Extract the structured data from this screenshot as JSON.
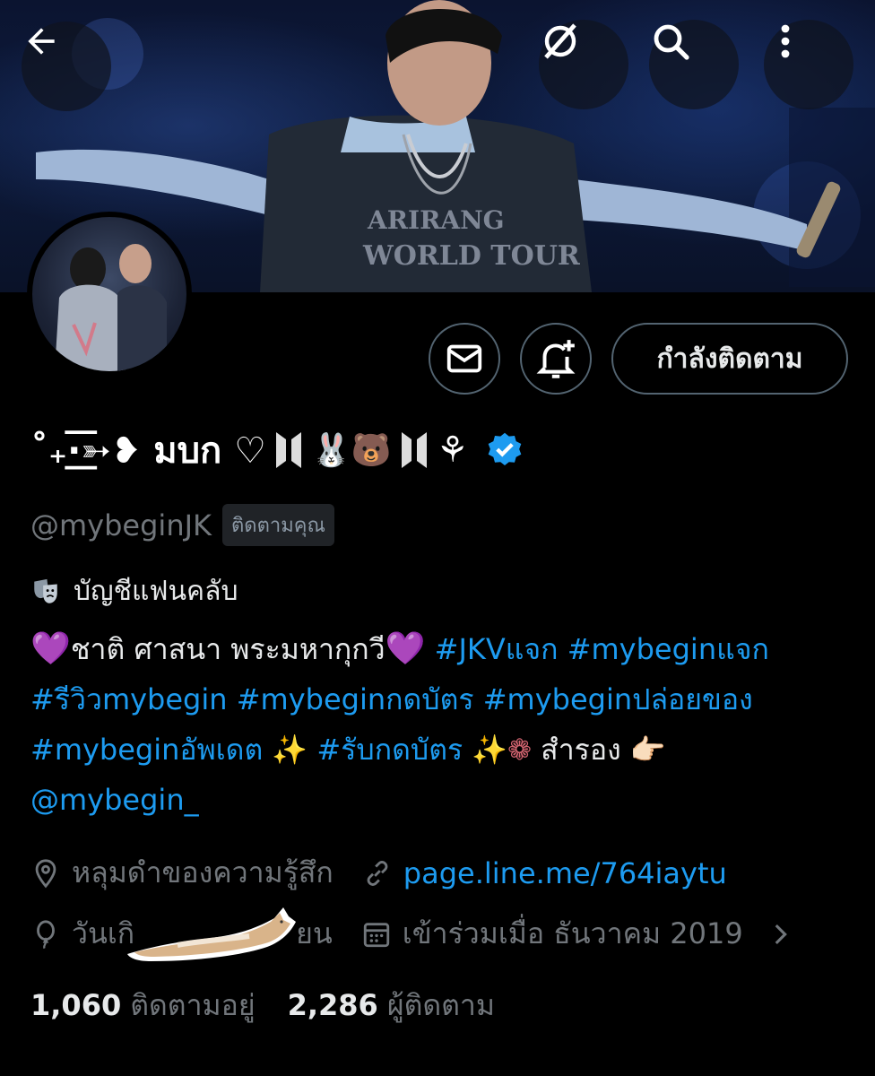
{
  "header": {
    "back_icon": "arrow-left-icon",
    "grok_icon": "grok-icon",
    "search_icon": "search-icon",
    "more_icon": "more-vertical-icon",
    "banner_text_line1": "ARIRANG",
    "banner_text_line2": "WORLD TOUR"
  },
  "actions": {
    "message_icon": "mail-icon",
    "notify_icon": "bell-plus-icon",
    "follow_label": "กำลังติดตาม"
  },
  "profile": {
    "name_prefix": "˚₊·͟͟͞͞➳❥ มบก ♡",
    "name_emoji": "🐰🐻",
    "name_suffix": "⚘",
    "verified_icon": "verified-badge-icon",
    "handle": "@mybeginJK",
    "follows_you": "ติดตามคุณ",
    "fan_icon": "theater-masks-icon",
    "fan_label": "บัญชีแฟนคลับ"
  },
  "bio": {
    "emoji_start": "💜",
    "text1": "ชาติ ศาสนา พระมหากุกวี",
    "emoji_mid": "💜",
    "tag1": "#JKVแจก",
    "tag2": "#mybeginแจก",
    "tag3": "#รีวิวmybegin",
    "tag4": "#mybeginกดบัตร",
    "tag5": "#mybeginปล่อยของ",
    "tag6": "#mybeginอัพเดต",
    "sparkle1": "✨",
    "tag7": "#รับกดบัตร",
    "sparkle2": "✨",
    "flower": "❁",
    "text2": "สำรอง",
    "point": "👉🏻",
    "mention": "@mybegin_"
  },
  "meta": {
    "location_icon": "location-pin-icon",
    "location": "หลุมดำของความรู้สึก",
    "link_icon": "link-icon",
    "link": "page.line.me/764iaytu",
    "birthday_icon": "balloon-icon",
    "birthday_start": "วันเกิ",
    "birthday_end": "ยน",
    "joined_icon": "calendar-icon",
    "joined": "เข้าร่วมเมื่อ ธันวาคม 2019",
    "chevron_icon": "chevron-right-icon"
  },
  "stats": {
    "following_count": "1,060",
    "following_label": "ติดตามอยู่",
    "followers_count": "2,286",
    "followers_label": "ผู้ติดตาม"
  },
  "colors": {
    "background": "#000000",
    "link": "#1d9bf0",
    "muted": "#71767b",
    "border": "#536471",
    "verified": "#1d9bf0"
  }
}
